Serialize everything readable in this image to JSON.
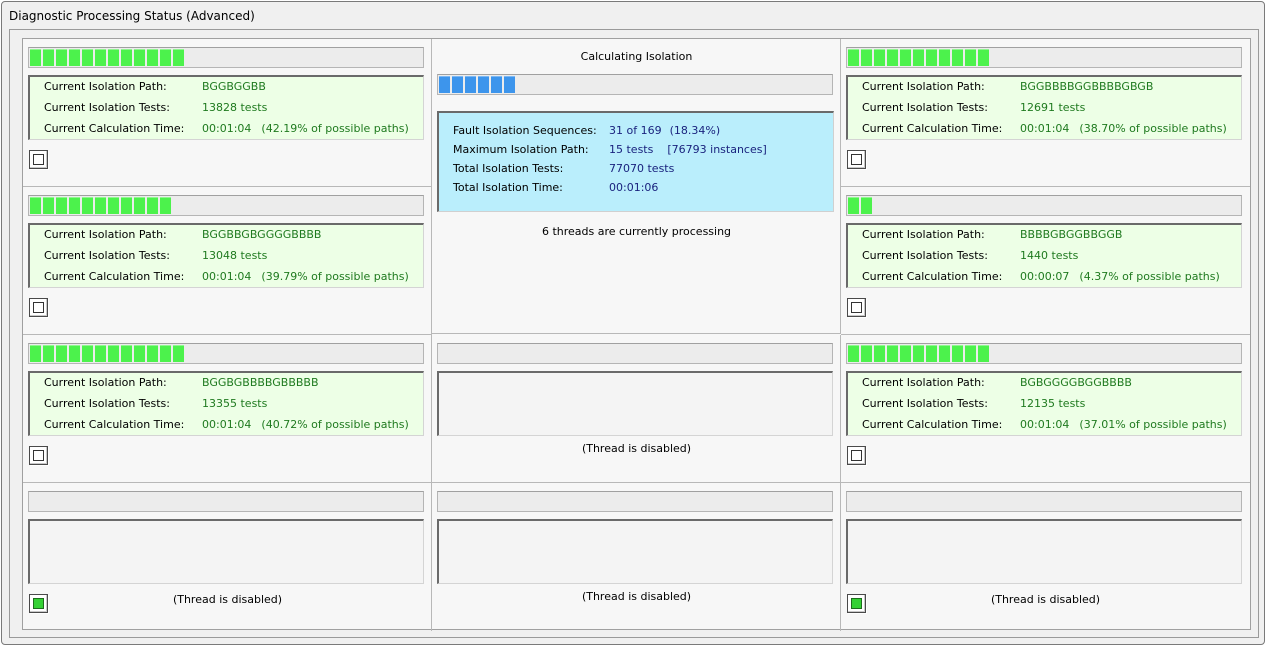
{
  "window": {
    "title": "Diagnostic Processing Status (Advanced)"
  },
  "labels": {
    "path": "Current Isolation Path:",
    "tests": "Current Isolation Tests:",
    "time": "Current Calculation Time:",
    "disabled": "(Thread is disabled)"
  },
  "summary": {
    "heading": "Calculating Isolation",
    "progress_segments": 6,
    "sequences_label": "Fault Isolation Sequences:",
    "sequences_value": "31 of 169",
    "sequences_pct": "(18.34%)",
    "max_path_label": "Maximum Isolation Path:",
    "max_path_value": "15 tests",
    "max_path_instances": "[76793 instances]",
    "total_tests_label": "Total Isolation Tests:",
    "total_tests_value": "77070 tests",
    "total_time_label": "Total Isolation Time:",
    "total_time_value": "00:01:06",
    "threads_status": "6 threads are currently processing"
  },
  "threads": [
    {
      "id": "t1",
      "enabled": true,
      "progress_segments": 12,
      "path": "BGGBGGBB",
      "tests": "13828 tests",
      "time": "00:01:04",
      "pct": "(42.19% of possible paths)",
      "checked": false
    },
    {
      "id": "t2",
      "enabled": true,
      "progress_segments": 11,
      "path": "BGGBBGBGGGGBBBB",
      "tests": "13048 tests",
      "time": "00:01:04",
      "pct": "(39.79% of possible paths)",
      "checked": false
    },
    {
      "id": "t3",
      "enabled": true,
      "progress_segments": 12,
      "path": "BGGBGBBBBGBBBBB",
      "tests": "13355 tests",
      "time": "00:01:04",
      "pct": "(40.72% of possible paths)",
      "checked": false
    },
    {
      "id": "t4",
      "enabled": false,
      "checked": true
    },
    {
      "id": "t5",
      "enabled": false
    },
    {
      "id": "t6",
      "enabled": false
    },
    {
      "id": "t7",
      "enabled": true,
      "progress_segments": 11,
      "path": "BGGBBBBGGBBBBGBGB",
      "tests": "12691 tests",
      "time": "00:01:04",
      "pct": "(38.70% of possible paths)",
      "checked": false
    },
    {
      "id": "t8",
      "enabled": true,
      "progress_segments": 2,
      "path": "BBBBGBGGBBGGB",
      "tests": "1440 tests",
      "time": "00:00:07",
      "pct": "(4.37% of possible paths)",
      "checked": false
    },
    {
      "id": "t9",
      "enabled": true,
      "progress_segments": 11,
      "path": "BGBGGGGBGGBBBB",
      "tests": "12135 tests",
      "time": "00:01:04",
      "pct": "(37.01% of possible paths)",
      "checked": false
    },
    {
      "id": "t10",
      "enabled": false,
      "checked": true
    }
  ],
  "colors": {
    "progress_green": "#4cf24c",
    "progress_blue": "#3d95ec",
    "info_green_bg": "#edffe6",
    "summary_bg": "#baeefc",
    "value_green": "#1f7a1f",
    "value_navy": "#1a237e"
  }
}
